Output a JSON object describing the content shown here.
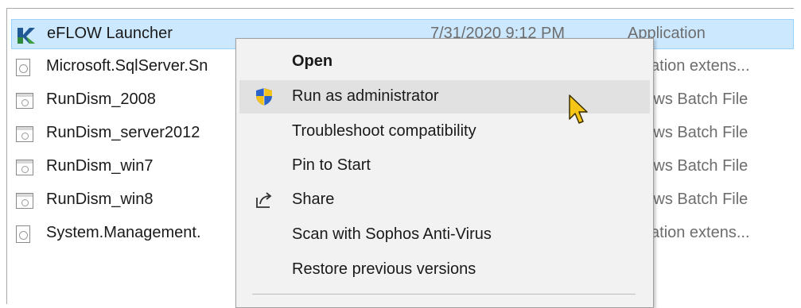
{
  "files": [
    {
      "name": "eFLOW Launcher",
      "date": "7/31/2020 9:12 PM",
      "type": "Application",
      "icon": "eflow-app-icon",
      "selected": true
    },
    {
      "name": "Microsoft.SqlServer.Sn",
      "date": "",
      "type": "plication extens...",
      "icon": "dll-file-icon"
    },
    {
      "name": "RunDism_2008",
      "date": "",
      "type": "ndows Batch File",
      "icon": "batch-file-icon"
    },
    {
      "name": "RunDism_server2012",
      "date": "",
      "type": "ndows Batch File",
      "icon": "batch-file-icon"
    },
    {
      "name": "RunDism_win7",
      "date": "",
      "type": "ndows Batch File",
      "icon": "batch-file-icon"
    },
    {
      "name": "RunDism_win8",
      "date": "",
      "type": "ndows Batch File",
      "icon": "batch-file-icon"
    },
    {
      "name": "System.Management.",
      "date": "",
      "type": "plication extens...",
      "icon": "dll-file-icon"
    }
  ],
  "context_menu": {
    "items": [
      {
        "label": "Open",
        "bold": true
      },
      {
        "label": "Run as administrator",
        "icon": "uac-shield-icon",
        "hover": true
      },
      {
        "label": "Troubleshoot compatibility"
      },
      {
        "label": "Pin to Start"
      },
      {
        "label": "Share",
        "icon": "share-icon"
      },
      {
        "label": "Scan with Sophos Anti-Virus"
      },
      {
        "label": "Restore previous versions"
      }
    ]
  },
  "colors": {
    "selection": "#cce8ff",
    "menu_bg": "#f2f2f2",
    "hover": "#e1e1e1",
    "cursor": "#f5c518"
  }
}
